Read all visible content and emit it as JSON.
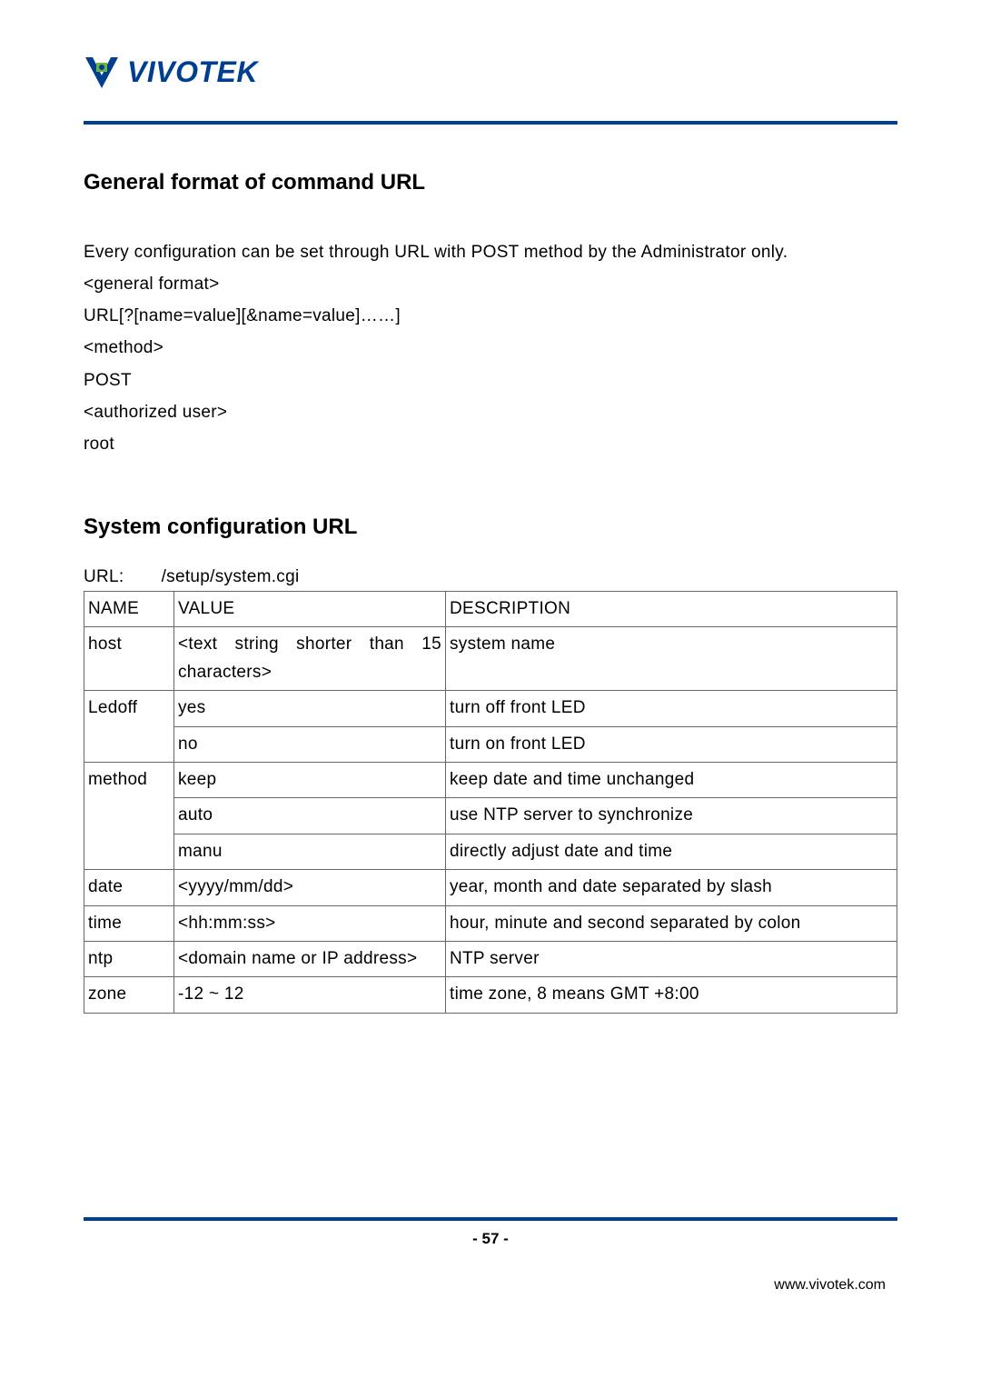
{
  "logo_text": "VIVOTEK",
  "section1": {
    "heading": "General format of command URL",
    "intro": "Every configuration can be set through URL with POST method by the Administrator only.",
    "lines": [
      "<general format>",
      "URL[?[name=value][&name=value]……]",
      "<method>",
      "POST",
      "<authorized user>",
      "root"
    ]
  },
  "section2": {
    "heading": "System configuration URL",
    "url_label": "URL:",
    "url_value": "/setup/system.cgi",
    "table": {
      "headers": [
        "NAME",
        "VALUE",
        "DESCRIPTION"
      ],
      "rows": [
        {
          "name": "host",
          "value": "<text string shorter than 15 characters>",
          "desc": "system name",
          "name_rows": 1,
          "value_just": true
        },
        {
          "name": "Ledoff",
          "value": "yes",
          "desc": "turn off front LED",
          "name_rows": 2
        },
        {
          "value": "no",
          "desc": "turn on front LED"
        },
        {
          "name": "method",
          "value": "keep",
          "desc": "keep date and time unchanged",
          "name_rows": 3
        },
        {
          "value": "auto",
          "desc": "use NTP server to synchronize"
        },
        {
          "value": "manu",
          "desc": "directly adjust date and time"
        },
        {
          "name": "date",
          "value": "<yyyy/mm/dd>",
          "desc": "year, month and date separated by slash",
          "name_rows": 1,
          "desc_just": true
        },
        {
          "name": "time",
          "value": "<hh:mm:ss>",
          "desc": "hour, minute and second separated by colon",
          "name_rows": 1,
          "desc_just": true
        },
        {
          "name": "ntp",
          "value": "<domain name or IP address>",
          "desc": "NTP server",
          "name_rows": 1
        },
        {
          "name": "zone",
          "value": "-12 ~ 12",
          "desc": "time zone, 8 means GMT +8:00",
          "name_rows": 1
        }
      ]
    }
  },
  "footer": {
    "page_number": "- 57 -",
    "url": "www.vivotek.com"
  }
}
